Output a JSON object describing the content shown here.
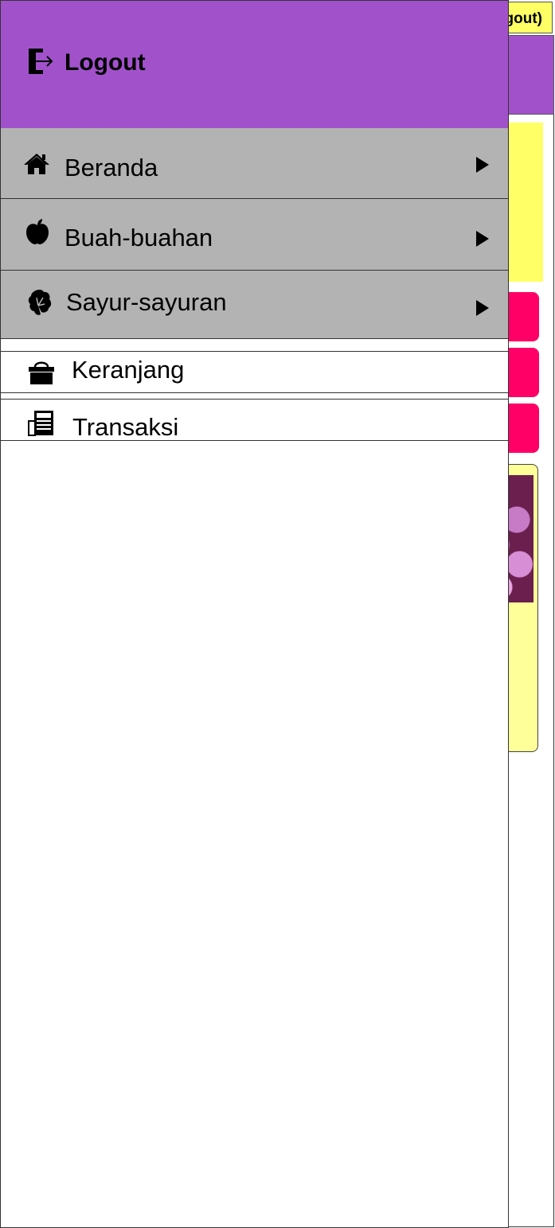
{
  "background": {
    "topbar_text": "gout)"
  },
  "drawer": {
    "header": {
      "logout_label": "Logout",
      "logout_icon": "logout-icon",
      "color": "#a152cb"
    },
    "menu": [
      {
        "label": "Beranda",
        "icon": "home-icon",
        "has_submenu": true
      },
      {
        "label": "Buah-buahan",
        "icon": "apple-icon",
        "has_submenu": true
      },
      {
        "label": "Sayur-sayuran",
        "icon": "vegetable-icon",
        "has_submenu": true
      }
    ],
    "links": [
      {
        "label": "Keranjang",
        "icon": "basket-icon"
      },
      {
        "label": "Transaksi",
        "icon": "receipt-icon"
      }
    ]
  },
  "colors": {
    "drawer_header": "#a152cb",
    "menu_bg": "#b3b3b3",
    "accent_yellow": "#ffff66",
    "accent_pink": "#ff0066"
  }
}
